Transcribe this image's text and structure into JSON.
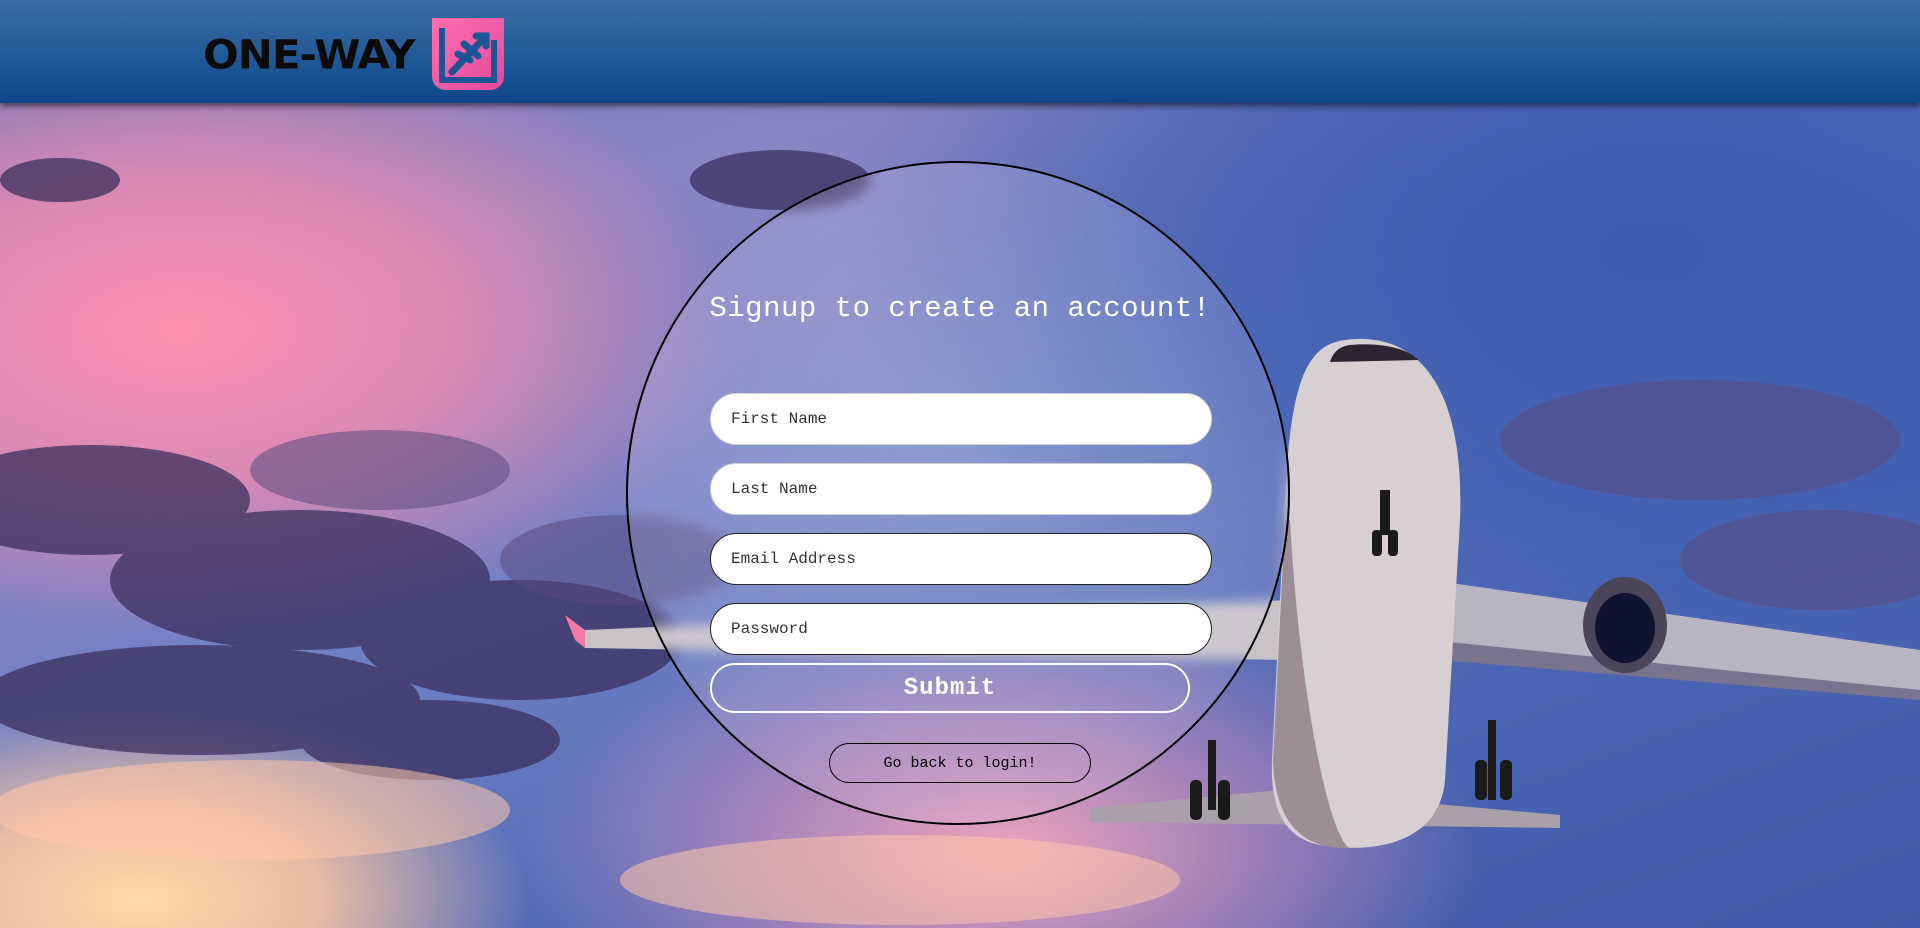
{
  "header": {
    "logo_text": "ONE-WAY",
    "logo_mark_icon": "plane-badge-icon"
  },
  "form": {
    "title": "Signup to create an account!",
    "first_name_placeholder": "First Name",
    "last_name_placeholder": "Last Name",
    "email_placeholder": "Email Address",
    "password_placeholder": "Password",
    "submit_label": "Submit",
    "back_label": "Go back to login!"
  },
  "colors": {
    "header_top": "#3b6da3",
    "header_bottom": "#0e468a",
    "logo_mark": "#ee5aa6"
  }
}
